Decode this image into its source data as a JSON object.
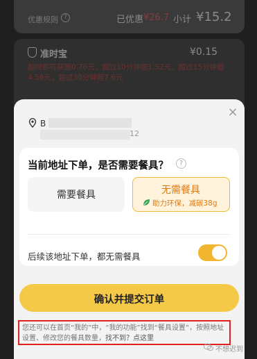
{
  "background": {
    "promo_label": "优惠规则",
    "saved_label": "已优惠",
    "saved_value": "¥26.7",
    "subtotal_label": "小计",
    "subtotal_value": "¥15.2",
    "ontime_label": "准时宝",
    "ontime_price": "¥0.15",
    "ontime_desc": "超时即可获赔0.76元，超过10分钟赔1.52元，超过15分钟赔4.56元，超过30分钟赔7.6元"
  },
  "sheet": {
    "address_line1": "B",
    "address_line2": "12",
    "question": "当前地址下单，是否需要餐具？",
    "help_icon": "?",
    "option_need": "需要餐具",
    "option_noneed": "无需餐具",
    "option_noneed_sub": "助力环保，减碳38g",
    "pref_label": "后续该地址下单，都无需餐具",
    "toggle_on": true,
    "submit_label": "确认并提交订单",
    "note_text": "您还可以在首页“我的”中，“我的功能”找到“餐具设置”，按照地址设置、修改您的餐具数量，",
    "note_link": "找不到？点这里",
    "close_symbol": "×"
  },
  "watermark": "不想迟到",
  "colors": {
    "accent": "#f5c948",
    "selected_border": "#f0b63a",
    "selected_text": "#e07a10",
    "highlight_box": "#e02020"
  }
}
